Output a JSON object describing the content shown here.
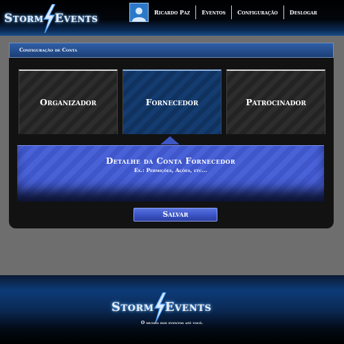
{
  "brand": {
    "logo_left": "Storm",
    "logo_right": "Events",
    "accent": "#4fa3ff"
  },
  "header": {
    "avatar_icon": "user-icon",
    "user_name": "Ricardo Paz",
    "menu": [
      "Eventos",
      "Configuração",
      "Deslogar"
    ]
  },
  "panel": {
    "title": "Configuração de Conta",
    "account_types": [
      "Organizador",
      "Fornecedor",
      "Patrocinador"
    ],
    "selected_type": "Fornecedor",
    "detail_title": "Detalhe da Conta Fornecedor",
    "detail_subtitle": "Ex.: Permições, Ações, etc...",
    "save_label": "Salvar"
  },
  "footer": {
    "logo_left": "Storm",
    "logo_right": "Events",
    "tagline": "O mundo dos eventos até você."
  },
  "colors": {
    "page_bg": "#6e6e6e",
    "panel_bg": "#121212",
    "selected_card": "#143c70",
    "detail_bg": "#4a62d8"
  }
}
